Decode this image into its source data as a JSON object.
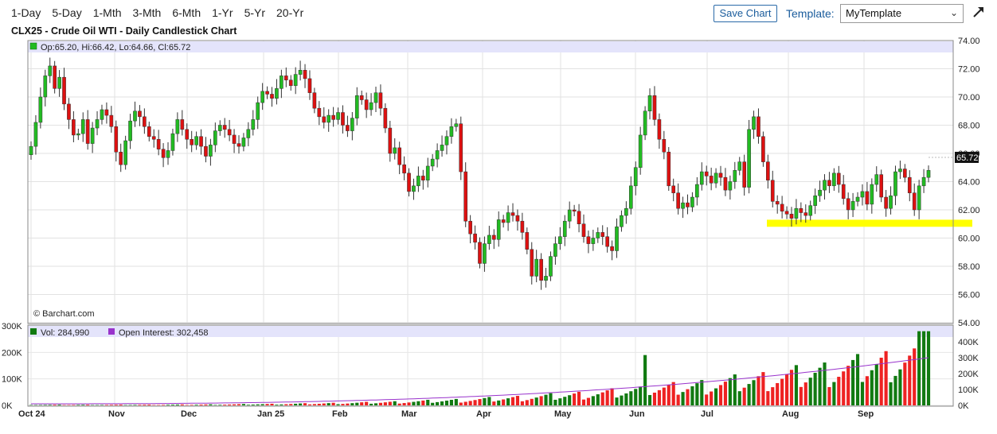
{
  "toolbar": {
    "periods": [
      "1-Day",
      "5-Day",
      "1-Mth",
      "3-Mth",
      "6-Mth",
      "1-Yr",
      "5-Yr",
      "20-Yr"
    ],
    "save_label": "Save Chart",
    "template_label": "Template:",
    "template_value": "MyTemplate"
  },
  "chart_title": "CLX25 - Crude Oil WTI - Daily Candlestick Chart",
  "price_info": "Op:65.20, Hi:66.42, Lo:64.66, Cl:65.72",
  "credit": "© Barchart.com",
  "last_price_label": "65.72",
  "volume_info": "Vol: 284,990",
  "oi_info": "Open Interest: 302,458",
  "colors": {
    "up": "#22bb22",
    "down": "#dd1111",
    "vol_up": "#117a11",
    "vol_down": "#ee2222",
    "oi_line": "#9933cc",
    "support": "#ffff00",
    "legend_band": "#e4e4fb"
  },
  "chart_data": {
    "type": "candlestick",
    "title": "CLX25 - Crude Oil WTI - Daily Candlestick Chart",
    "x_ticks": [
      "Oct 24",
      "Nov",
      "Dec",
      "Jan 25",
      "Feb",
      "Mar",
      "Apr",
      "May",
      "Jun",
      "Jul",
      "Aug",
      "Sep"
    ],
    "y_ticks": [
      "74.00",
      "72.00",
      "70.00",
      "68.00",
      "66.00",
      "64.00",
      "62.00",
      "60.00",
      "58.00",
      "56.00",
      "54.00"
    ],
    "ylim": [
      54,
      74
    ],
    "grid": true,
    "last_price": 65.72,
    "support_zone": [
      60.8,
      61.3
    ],
    "closes": [
      66.5,
      68.2,
      70.0,
      71.5,
      72.2,
      70.6,
      71.4,
      69.5,
      68.4,
      67.3,
      67.4,
      68.4,
      66.7,
      67.8,
      68.4,
      69.1,
      68.7,
      67.9,
      66.1,
      65.2,
      66.9,
      68.3,
      69.0,
      68.6,
      67.9,
      67.2,
      67.0,
      66.3,
      65.7,
      66.2,
      67.4,
      68.4,
      67.7,
      67.0,
      66.6,
      67.2,
      66.5,
      65.8,
      66.6,
      67.6,
      68.0,
      67.7,
      67.3,
      66.7,
      66.5,
      67.1,
      67.7,
      68.4,
      69.6,
      70.4,
      70.2,
      69.9,
      70.6,
      71.5,
      71.2,
      70.8,
      71.6,
      71.9,
      71.3,
      70.3,
      69.2,
      68.6,
      68.2,
      68.7,
      68.4,
      68.9,
      68.0,
      67.6,
      68.5,
      70.1,
      69.8,
      69.1,
      69.6,
      70.3,
      69.2,
      67.8,
      66.0,
      66.4,
      65.2,
      64.6,
      63.3,
      63.7,
      64.4,
      64.1,
      65.1,
      65.6,
      66.2,
      66.6,
      67.2,
      67.9,
      68.1,
      64.7,
      61.2,
      60.3,
      59.7,
      58.2,
      59.6,
      60.2,
      59.9,
      61.3,
      61.1,
      61.8,
      61.6,
      61.2,
      60.4,
      59.2,
      57.3,
      58.5,
      57.0,
      57.3,
      58.7,
      59.6,
      60.1,
      61.2,
      62.0,
      61.9,
      61.0,
      60.1,
      59.6,
      60.0,
      60.4,
      60.1,
      59.4,
      59.1,
      60.8,
      61.6,
      62.1,
      63.7,
      65.0,
      67.3,
      69.0,
      70.1,
      68.4,
      67.0,
      66.1,
      63.7,
      63.2,
      62.1,
      62.5,
      62.2,
      62.9,
      63.8,
      64.7,
      64.4,
      63.9,
      64.6,
      64.3,
      63.4,
      64.0,
      64.8,
      65.4,
      63.6,
      67.7,
      68.6,
      67.2,
      65.4,
      64.1,
      62.6,
      62.4,
      61.9,
      61.7,
      61.4,
      62.1,
      61.8,
      61.6,
      62.3,
      63.0,
      63.4,
      64.1,
      63.7,
      64.6,
      63.8,
      62.8,
      62.0,
      62.6,
      62.9,
      63.3,
      62.4,
      63.8,
      64.5,
      62.9,
      62.1,
      63.0,
      64.7,
      64.9,
      64.3,
      63.2,
      62.0,
      63.7,
      64.3,
      64.8
    ]
  }
}
